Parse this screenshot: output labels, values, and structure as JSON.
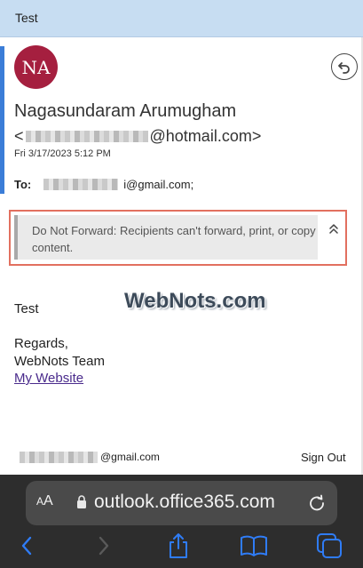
{
  "header": {
    "subject": "Test"
  },
  "message": {
    "avatar_initials": "NA",
    "sender_name": "Nagasundaram Arumugham",
    "sender_address_prefix": "<",
    "sender_address_suffix": "@hotmail.com>",
    "date": "Fri 3/17/2023 5:12 PM",
    "to_label": "To:",
    "to_suffix": "i@gmail.com;",
    "notice": "Do Not Forward: Recipients can't forward, print, or copy content.",
    "watermark": "WebNots.com",
    "body_line1": "Test",
    "body_line2": "Regards,",
    "body_line3": "WebNots Team",
    "link_text": "My Website"
  },
  "footer": {
    "account_suffix": "@gmail.com",
    "sign_out": "Sign Out"
  },
  "browser": {
    "text_size_big": "A",
    "text_size_small": "A",
    "url": "outlook.office365.com"
  },
  "colors": {
    "header_bg": "#c7ddf2",
    "avatar_bg": "#a51f3f",
    "notice_outline": "#e2705f",
    "link": "#4a2b8c",
    "toolbar_icon": "#2f7cf6"
  }
}
